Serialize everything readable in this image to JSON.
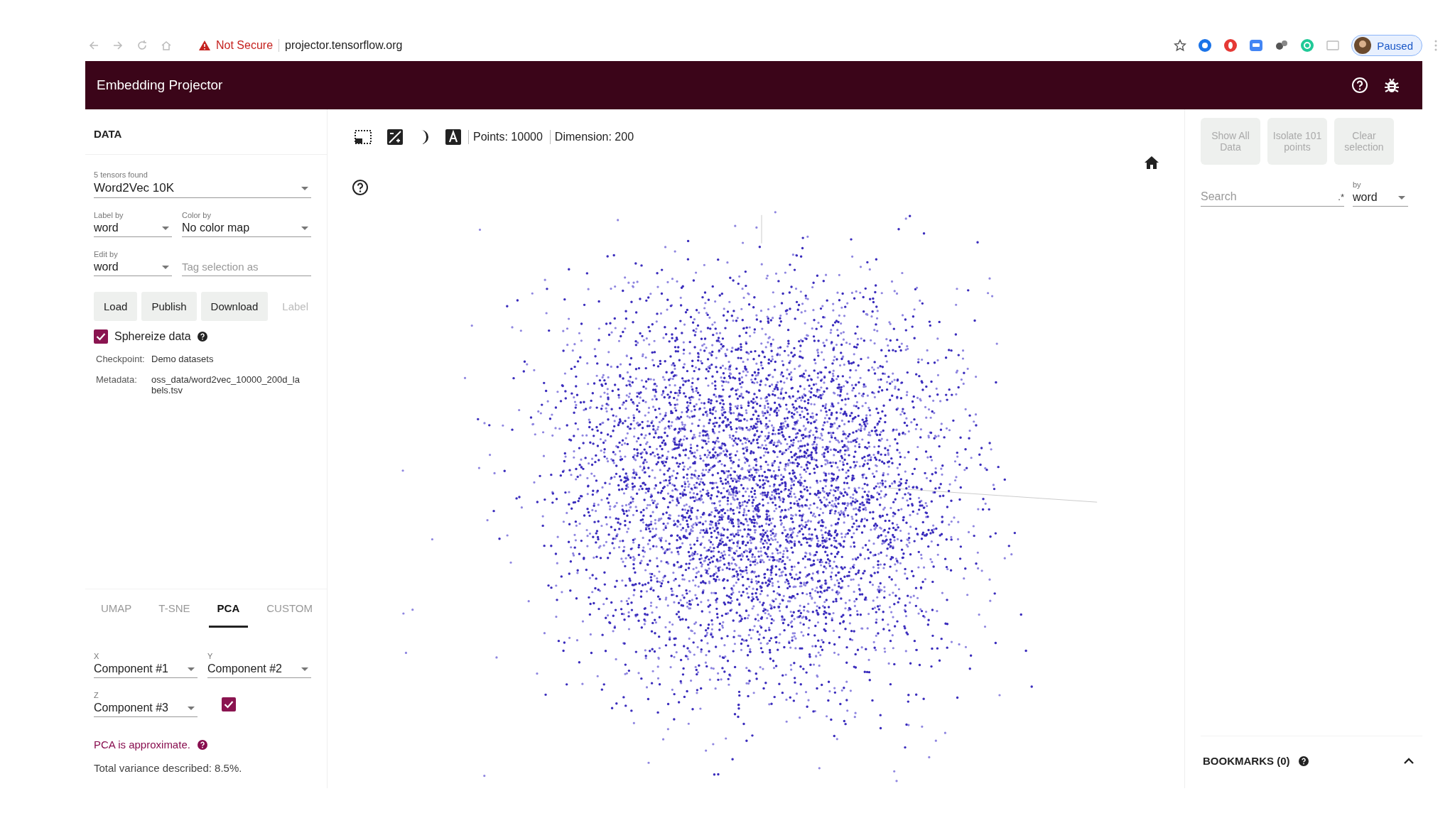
{
  "browser": {
    "warning": "Not Secure",
    "url": "projector.tensorflow.org",
    "profile": "Paused"
  },
  "app": {
    "title": "Embedding Projector"
  },
  "data_panel": {
    "heading": "DATA",
    "tensor": {
      "label": "5 tensors found",
      "value": "Word2Vec 10K"
    },
    "label_by": {
      "label": "Label by",
      "value": "word"
    },
    "color_by": {
      "label": "Color by",
      "value": "No color map"
    },
    "edit_by": {
      "label": "Edit by",
      "value": "word"
    },
    "tag": {
      "placeholder": "Tag selection as"
    },
    "buttons": [
      {
        "label": "Load",
        "disabled": false
      },
      {
        "label": "Publish",
        "disabled": false
      },
      {
        "label": "Download",
        "disabled": false
      },
      {
        "label": "Label",
        "disabled": true
      }
    ],
    "sphereize": {
      "label": "Sphereize data",
      "checked": true
    },
    "info": [
      {
        "key": "Checkpoint:",
        "value": "Demo datasets"
      },
      {
        "key": "Metadata:",
        "value": "oss_data/word2vec_10000_200d_labels.tsv"
      }
    ]
  },
  "projection": {
    "tabs": [
      {
        "label": "UMAP",
        "selected": false
      },
      {
        "label": "T-SNE",
        "selected": false
      },
      {
        "label": "PCA",
        "selected": true
      },
      {
        "label": "CUSTOM",
        "selected": false
      }
    ],
    "x": {
      "label": "X",
      "value": "Component #1"
    },
    "y": {
      "label": "Y",
      "value": "Component #2"
    },
    "z": {
      "label": "Z",
      "value": "Component #3"
    },
    "z_enabled": {
      "checked": true
    },
    "note": "PCA is approximate.",
    "variance": "Total variance described: 8.5%."
  },
  "toolbar": {
    "points": "Points: 10000",
    "dimension": "Dimension: 200"
  },
  "inspector": {
    "buttons": [
      {
        "label": "Show All Data",
        "disabled": true
      },
      {
        "label": "Isolate 101 points",
        "disabled": true
      },
      {
        "label": "Clear selection",
        "disabled": true
      }
    ],
    "search": {
      "placeholder": "Search"
    },
    "regex": ".*",
    "by": {
      "label": "by",
      "value": "word"
    }
  },
  "bookmarks": {
    "title": "BOOKMARKS (0)"
  }
}
